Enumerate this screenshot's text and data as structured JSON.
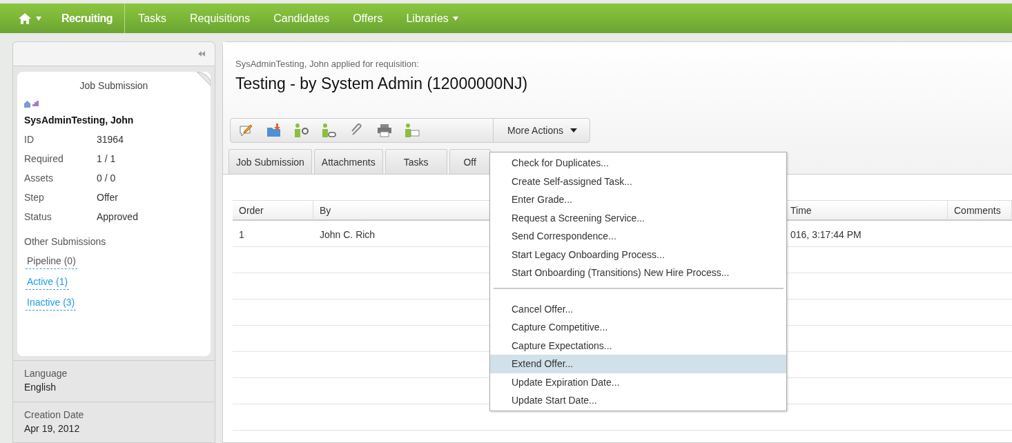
{
  "nav": {
    "items": [
      {
        "label": "Recruiting",
        "selected": true,
        "dropdown": false
      },
      {
        "label": "Tasks",
        "selected": false,
        "dropdown": false
      },
      {
        "label": "Requisitions",
        "selected": false,
        "dropdown": false
      },
      {
        "label": "Candidates",
        "selected": false,
        "dropdown": false
      },
      {
        "label": "Offers",
        "selected": false,
        "dropdown": false
      },
      {
        "label": "Libraries",
        "selected": false,
        "dropdown": true
      }
    ]
  },
  "sidebar": {
    "card": {
      "title": "Job Submission",
      "name": "SysAdminTesting, John",
      "fields": [
        {
          "label": "ID",
          "value": "31964"
        },
        {
          "label": "Required",
          "value": "1 / 1"
        },
        {
          "label": "Assets",
          "value": "0 / 0"
        },
        {
          "label": "Step",
          "value": "Offer"
        },
        {
          "label": "Status",
          "value": "Approved"
        }
      ],
      "other_title": "Other Submissions",
      "links": [
        {
          "label": "Pipeline (0)",
          "disabled": true
        },
        {
          "label": "Active (1)",
          "disabled": false
        },
        {
          "label": "Inactive (3)",
          "disabled": false
        }
      ]
    },
    "sections": [
      {
        "label": "Language",
        "value": "English"
      },
      {
        "label": "Creation Date",
        "value": "Apr 19, 2012"
      }
    ]
  },
  "header": {
    "subtitle": "SysAdminTesting, John applied for requisition:",
    "title": "Testing - by System Admin (12000000NJ)"
  },
  "toolbar": {
    "more_actions": "More Actions"
  },
  "tabs": [
    {
      "label": "Job Submission"
    },
    {
      "label": "Attachments"
    },
    {
      "label": "Tasks"
    },
    {
      "label": "Off"
    }
  ],
  "table": {
    "columns": [
      "Order",
      "By",
      "Time",
      "Comments"
    ],
    "rows": [
      [
        "1",
        "John C. Rich",
        "016, 3:17:44 PM",
        ""
      ]
    ]
  },
  "menu": {
    "groups": [
      [
        {
          "label": "Check for Duplicates...",
          "selected": false
        },
        {
          "label": "Create Self-assigned Task...",
          "selected": false
        },
        {
          "label": "Enter Grade...",
          "selected": false
        },
        {
          "label": "Request a Screening Service...",
          "selected": false
        },
        {
          "label": "Send Correspondence...",
          "selected": false
        },
        {
          "label": "Start Legacy Onboarding Process...",
          "selected": false
        },
        {
          "label": "Start Onboarding (Transitions) New Hire Process...",
          "selected": false
        }
      ],
      [
        {
          "label": "Cancel Offer...",
          "selected": false
        },
        {
          "label": "Capture Competitive...",
          "selected": false
        },
        {
          "label": "Capture Expectations...",
          "selected": false
        },
        {
          "label": "Extend Offer...",
          "selected": true
        },
        {
          "label": "Update Expiration Date...",
          "selected": false
        },
        {
          "label": "Update Start Date...",
          "selected": false
        }
      ]
    ]
  }
}
